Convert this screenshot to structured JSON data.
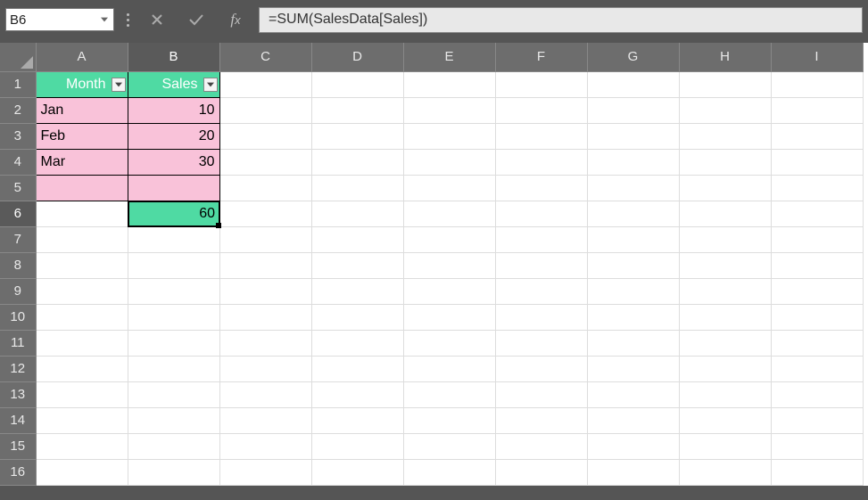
{
  "nameBox": "B6",
  "formula": "=SUM(SalesData[Sales])",
  "columns": [
    "A",
    "B",
    "C",
    "D",
    "E",
    "F",
    "G",
    "H",
    "I"
  ],
  "activeCol": "B",
  "activeRow": 6,
  "rows": [
    1,
    2,
    3,
    4,
    5,
    6,
    7,
    8,
    9,
    10,
    11,
    12,
    13,
    14,
    15,
    16
  ],
  "table": {
    "headers": {
      "A": "Month",
      "B": "Sales"
    },
    "data": [
      {
        "A": "Jan",
        "B": "10"
      },
      {
        "A": "Feb",
        "B": "20"
      },
      {
        "A": "Mar",
        "B": "30"
      },
      {
        "A": "",
        "B": ""
      }
    ]
  },
  "sumValue": "60",
  "colors": {
    "headerTeal": "#4fdaa3",
    "dataPink": "#f9c2d9",
    "gridBg": "#6d6d6d"
  }
}
